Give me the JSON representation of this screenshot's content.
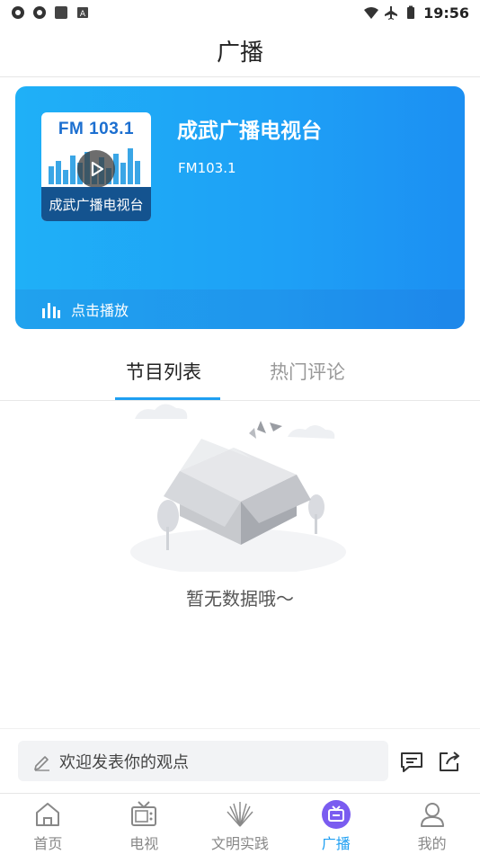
{
  "status_bar": {
    "time": "19:56"
  },
  "header": {
    "title": "广播"
  },
  "player": {
    "cover_fm": "FM 103.1",
    "cover_label": "成武广播电视台",
    "station_name": "成武广播电视台",
    "frequency": "FM103.1",
    "play_label": "点击播放"
  },
  "tabs": [
    {
      "label": "节目列表",
      "active": true
    },
    {
      "label": "热门评论",
      "active": false
    }
  ],
  "empty_state": {
    "message": "暂无数据哦～"
  },
  "comment": {
    "placeholder": "欢迎发表你的观点"
  },
  "bottom_nav": [
    {
      "label": "首页",
      "icon": "home-icon"
    },
    {
      "label": "电视",
      "icon": "tv-icon"
    },
    {
      "label": "文明实践",
      "icon": "civilization-icon"
    },
    {
      "label": "广播",
      "icon": "radio-icon",
      "active": true
    },
    {
      "label": "我的",
      "icon": "user-icon"
    }
  ],
  "colors": {
    "accent": "#1e9ff2",
    "card_start": "#1fb0f7",
    "card_end": "#1c8ff2"
  }
}
